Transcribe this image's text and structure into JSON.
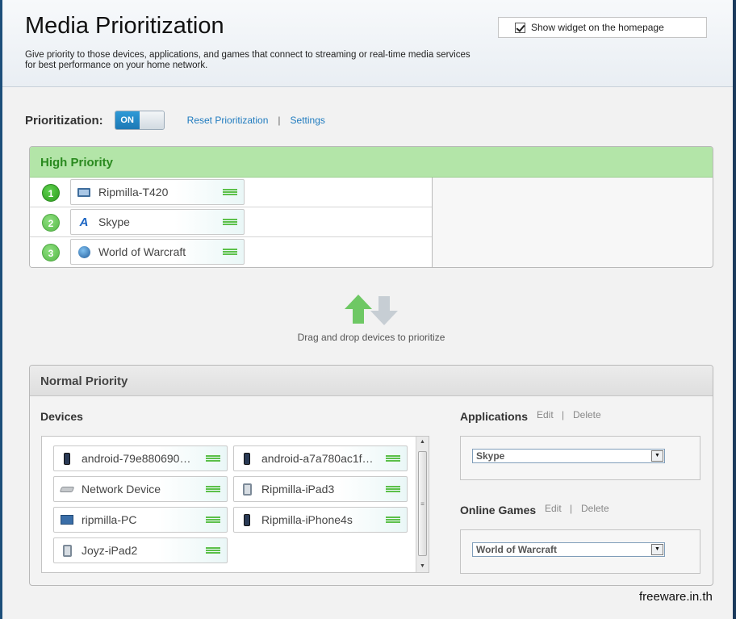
{
  "header": {
    "title": "Media Prioritization",
    "description": "Give priority to those devices, applications, and games that connect to streaming or real-time media services for best performance on your home network.",
    "widget_checkbox_label": "Show widget on the homepage",
    "widget_checked": true
  },
  "prioritization": {
    "label": "Prioritization:",
    "toggle_state": "ON",
    "reset_link": "Reset Prioritization",
    "separator": "|",
    "settings_link": "Settings"
  },
  "high_priority": {
    "title": "High Priority",
    "items": [
      {
        "rank": "1",
        "label": "Ripmilla-T420",
        "icon": "laptop-icon"
      },
      {
        "rank": "2",
        "label": "Skype",
        "icon": "skype-icon"
      },
      {
        "rank": "3",
        "label": "World of Warcraft",
        "icon": "globe-icon"
      }
    ]
  },
  "drag_drop": {
    "hint": "Drag and drop devices to prioritize"
  },
  "normal_priority": {
    "title": "Normal Priority",
    "devices_label": "Devices",
    "devices": [
      {
        "label": "android-79e880690…",
        "icon": "phone-icon"
      },
      {
        "label": "android-a7a780ac1f…",
        "icon": "phone-icon"
      },
      {
        "label": "Network Device",
        "icon": "network-device-icon"
      },
      {
        "label": "Ripmilla-iPad3",
        "icon": "tablet-icon"
      },
      {
        "label": "ripmilla-PC",
        "icon": "monitor-icon"
      },
      {
        "label": "Ripmilla-iPhone4s",
        "icon": "phone-icon"
      },
      {
        "label": "Joyz-iPad2",
        "icon": "tablet-icon"
      }
    ],
    "applications": {
      "label": "Applications",
      "edit": "Edit",
      "separator": "|",
      "delete": "Delete",
      "selected": "Skype"
    },
    "online_games": {
      "label": "Online Games",
      "edit": "Edit",
      "separator": "|",
      "delete": "Delete",
      "selected": "World of Warcraft"
    }
  },
  "watermark": "freeware.in.th",
  "colors": {
    "accent": "#1f7bbf",
    "high_priority_bg": "#b3e5a8",
    "high_priority_text": "#2a8a1f",
    "grip": "#5cc04a"
  }
}
